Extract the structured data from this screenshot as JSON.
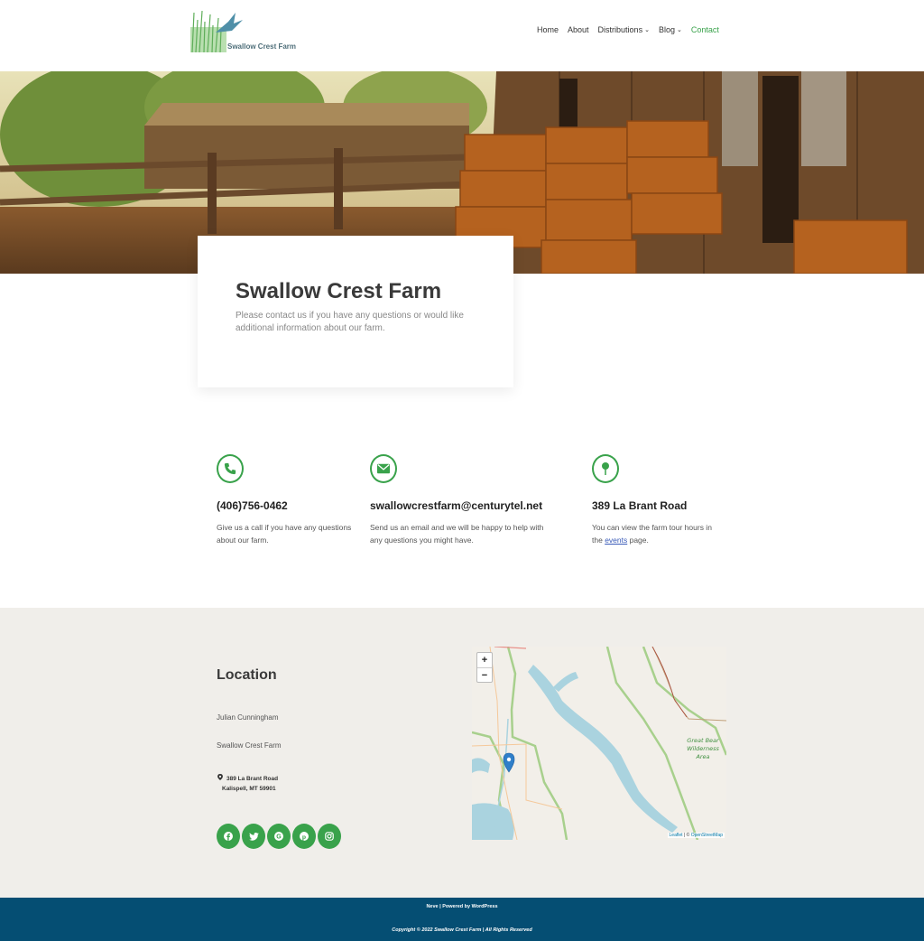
{
  "brand": {
    "name": "Swallow Crest Farm"
  },
  "nav": {
    "items": [
      {
        "label": "Home",
        "dropdown": false,
        "active": false
      },
      {
        "label": "About",
        "dropdown": false,
        "active": false
      },
      {
        "label": "Distributions",
        "dropdown": true,
        "active": false
      },
      {
        "label": "Blog",
        "dropdown": true,
        "active": false
      },
      {
        "label": "Contact",
        "dropdown": false,
        "active": true
      }
    ]
  },
  "intro": {
    "title": "Swallow Crest Farm",
    "text": "Please contact us if you have any questions or would like additional information about our farm."
  },
  "contacts": {
    "phone": {
      "icon": "phone-icon",
      "title": "(406)756-0462",
      "text": "Give us a call if you have any questions about our farm."
    },
    "email": {
      "icon": "envelope-icon",
      "title": "swallowcrestfarm@centurytel.net",
      "text": "Send us an email and we will be happy to help with any questions you might have."
    },
    "address": {
      "icon": "map-pin-icon",
      "title": "389 La Brant Road",
      "text_before": "You can view the farm tour hours in the ",
      "link": "events",
      "text_after": " page."
    }
  },
  "location": {
    "title": "Location",
    "person": "Julian Cunningham",
    "org": "Swallow Crest Farm",
    "street": "389 La Brant Road",
    "city": "Kalispell, MT 59901",
    "socials": [
      "facebook-icon",
      "twitter-icon",
      "google-icon",
      "pinterest-icon",
      "instagram-icon"
    ]
  },
  "map": {
    "zoom_in": "+",
    "zoom_out": "−",
    "label_area": [
      "Great Bear",
      "Wilderness",
      "Area"
    ],
    "attribution_leaflet": "Leaflet",
    "attribution_sep": " | © ",
    "attribution_osm": "OpenStreetMap"
  },
  "footer": {
    "credit": "Neve | Powered by WordPress",
    "copyright": "Copyright © 2022 Swallow Crest Farm | All Rights Reserved"
  },
  "colors": {
    "accent": "#39a24b",
    "footer_bg": "#054e73",
    "band_bg": "#f0eeea"
  }
}
